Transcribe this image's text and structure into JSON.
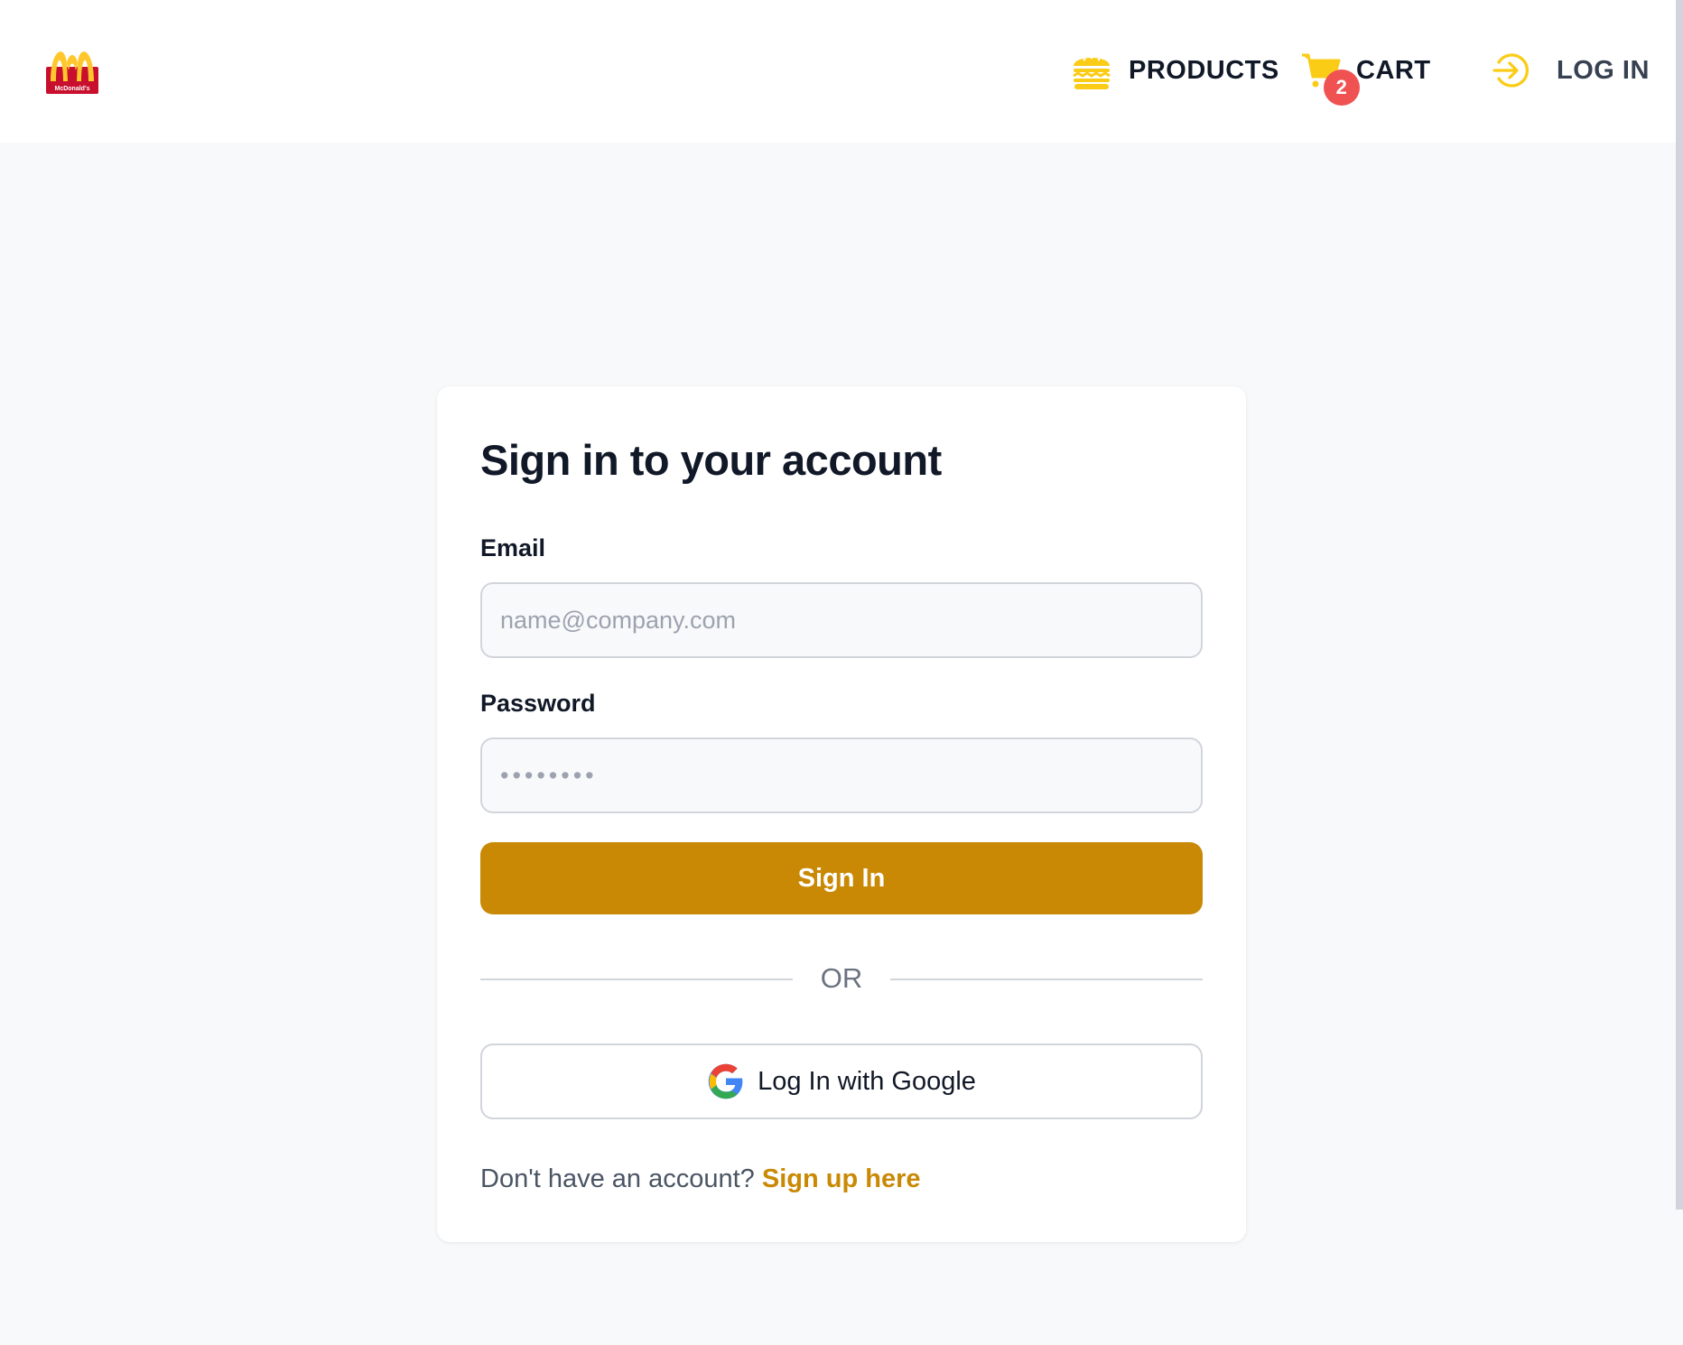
{
  "header": {
    "logo_text": "McDonald's",
    "nav": {
      "products_label": "PRODUCTS",
      "cart_label": "CART",
      "cart_count": "2",
      "login_label": "LOG IN"
    },
    "icons": {
      "products": "burger-icon",
      "cart": "cart-icon",
      "login": "login-arrow-icon"
    }
  },
  "login_card": {
    "title": "Sign in to your account",
    "email_label": "Email",
    "email_placeholder": "name@company.com",
    "password_label": "Password",
    "password_placeholder": "••••••••",
    "signin_button": "Sign In",
    "divider_text": "OR",
    "google_button": "Log In with Google",
    "signup_prompt": "Don't have an account?",
    "signup_link": "Sign up here"
  },
  "colors": {
    "accent": "#c98904",
    "nav_icon": "#facc15",
    "badge": "#f05252",
    "background": "#f8f9fb"
  }
}
